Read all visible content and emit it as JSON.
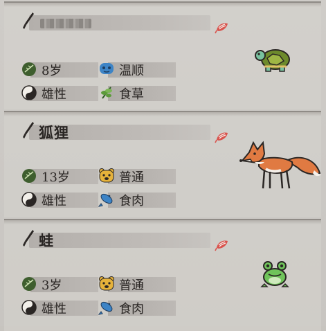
{
  "animals": [
    {
      "name": "",
      "name_obscured": true,
      "age": "8岁",
      "temperament": "温顺",
      "sex": "雄性",
      "diet": "食草",
      "sprite": "turtle"
    },
    {
      "name": "狐狸",
      "name_obscured": false,
      "age": "13岁",
      "temperament": "普通",
      "sex": "雄性",
      "diet": "食肉",
      "sprite": "fox"
    },
    {
      "name": "蛙",
      "name_obscured": false,
      "age": "3岁",
      "temperament": "普通",
      "sex": "雄性",
      "diet": "食肉",
      "sprite": "frog"
    }
  ],
  "icons": {
    "rename": "brush-icon",
    "favorite": "feather-icon",
    "age": "age-leaf-icon",
    "temperament_calm": "blue-face-icon",
    "temperament_normal": "bear-face-icon",
    "sex": "yin-yang-icon",
    "diet_herb": "plant-icon",
    "diet_meat": "fish-icon"
  },
  "colors": {
    "accent_red": "#d9534d",
    "leaf_green": "#3e5e2e",
    "blue_icon": "#3d84c6",
    "yellow_icon": "#e6b23a"
  }
}
